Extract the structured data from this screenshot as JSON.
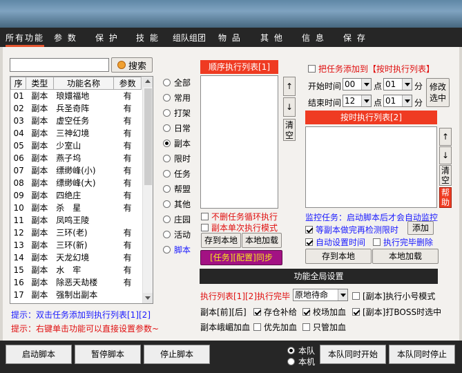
{
  "tabs": [
    {
      "label": "所有功能",
      "active": true
    },
    {
      "label": "参 数"
    },
    {
      "label": "保 护"
    },
    {
      "label": "技 能"
    },
    {
      "label": "组队组团"
    },
    {
      "label": "物 品"
    },
    {
      "label": "其 他"
    },
    {
      "label": "信 息"
    },
    {
      "label": "保 存"
    }
  ],
  "search": {
    "value": "",
    "button": "搜索"
  },
  "table": {
    "headers": [
      "序",
      "类型",
      "功能名称",
      "参数"
    ],
    "rows": [
      [
        "01",
        "副本",
        "琅嬛福地",
        "有"
      ],
      [
        "02",
        "副本",
        "兵圣奇阵",
        "有"
      ],
      [
        "03",
        "副本",
        "虚空任务",
        "有"
      ],
      [
        "04",
        "副本",
        "三神幻境",
        "有"
      ],
      [
        "05",
        "副本",
        "少室山",
        "有"
      ],
      [
        "06",
        "副本",
        "燕子坞",
        "有"
      ],
      [
        "07",
        "副本",
        "缥缈峰(小)",
        "有"
      ],
      [
        "08",
        "副本",
        "缥缈峰(大)",
        "有"
      ],
      [
        "09",
        "副本",
        "四绝庄",
        "有"
      ],
      [
        "10",
        "副本",
        "杀　星",
        "有"
      ],
      [
        "11",
        "副本",
        "凤鸣王陵",
        ""
      ],
      [
        "12",
        "副本",
        "三环(老)",
        "有"
      ],
      [
        "13",
        "副本",
        "三环(新)",
        "有"
      ],
      [
        "14",
        "副本",
        "天龙幻境",
        "有"
      ],
      [
        "15",
        "副本",
        "水　牢",
        "有"
      ],
      [
        "16",
        "副本",
        "除恶天劫楼",
        "有"
      ],
      [
        "17",
        "副本",
        "强制出副本",
        ""
      ]
    ]
  },
  "hints": {
    "line1": "提示：双击任务添加到执行列表[1][2]",
    "line2": "提示：右键单击功能可以直接设置参数~"
  },
  "categories": [
    {
      "label": "全部"
    },
    {
      "label": "常用"
    },
    {
      "label": "打架"
    },
    {
      "label": "日常"
    },
    {
      "label": "副本",
      "selected": true
    },
    {
      "label": "限时"
    },
    {
      "label": "任务"
    },
    {
      "label": "帮盟"
    },
    {
      "label": "其他"
    },
    {
      "label": "庄园"
    },
    {
      "label": "活动"
    },
    {
      "label": "脚本"
    }
  ],
  "seq_list": {
    "header": "顺序执行列表[1]",
    "up": "↑",
    "down": "↓",
    "clear": "清空",
    "opt_no_delete": "不删任务循环执行",
    "opt_single": "副本单次执行模式",
    "save": "存到本地",
    "load": "本地加载",
    "sync": "[任务][配置]同步"
  },
  "timed": {
    "add_label": "把任务添加到【按时执行列表】",
    "start_label": "开始时间",
    "start_hour": "00",
    "start_min": "01",
    "end_label": "结束时间",
    "end_hour": "12",
    "end_min": "01",
    "hour_unit": "点",
    "min_unit": "分",
    "modify": "修改选中",
    "header": "按时执行列表[2]",
    "up": "↑",
    "down": "↓",
    "clear": "清空",
    "help": "帮助",
    "monitor": "监控任务：启动脚本后才会自动监控",
    "wait_check": "等副本做完再检测限时",
    "add": "添加",
    "auto_time": "自动设置时间",
    "delete_done": "执行完毕删除",
    "save": "存到本地",
    "load": "本地加载"
  },
  "global": {
    "header": "功能全局设置",
    "exec_done": "执行列表[1][2]执行完毕",
    "exec_select": "原地待命",
    "small_mode": "[副本]执行小号模式",
    "dungeon_prefix": "副本[前][后]",
    "restock": "存仓补给",
    "school_add": "校场加血",
    "boss": "[副本]打BOSS时选中",
    "emei": "副本峨嵋加血",
    "priority": "优先加血",
    "only": "只管加血"
  },
  "bottom": {
    "start": "启动脚本",
    "pause": "暂停脚本",
    "stop": "停止脚本",
    "team": "本队",
    "machine": "本机",
    "team_start": "本队同时开始",
    "team_stop": "本队同时停止"
  },
  "colors": {
    "accent": "#ef3b22",
    "sync_bg": "#a31283",
    "sync_text": "#f5e81d",
    "hint": "#1a1aff",
    "hint2": "#e01010"
  }
}
